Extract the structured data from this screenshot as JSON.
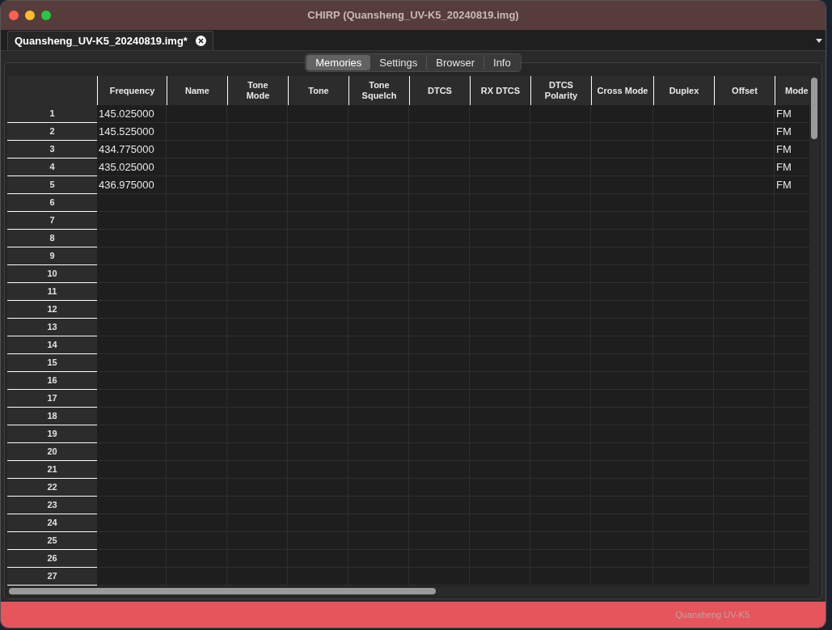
{
  "window": {
    "title": "CHIRP (Quansheng_UV-K5_20240819.img)"
  },
  "document_tab": {
    "label": "Quansheng_UV-K5_20240819.img*"
  },
  "tabs": [
    {
      "label": "Memories",
      "selected": true
    },
    {
      "label": "Settings",
      "selected": false
    },
    {
      "label": "Browser",
      "selected": false
    },
    {
      "label": "Info",
      "selected": false
    }
  ],
  "table": {
    "columns": [
      "Frequency",
      "Name",
      "Tone\nMode",
      "Tone",
      "Tone\nSquelch",
      "DTCS",
      "RX DTCS",
      "DTCS\nPolarity",
      "Cross Mode",
      "Duplex",
      "Offset",
      "Mode"
    ],
    "rows": [
      {
        "number": "1",
        "frequency": "145.025000",
        "mode": "FM"
      },
      {
        "number": "2",
        "frequency": "145.525000",
        "mode": "FM"
      },
      {
        "number": "3",
        "frequency": "434.775000",
        "mode": "FM"
      },
      {
        "number": "4",
        "frequency": "435.025000",
        "mode": "FM"
      },
      {
        "number": "5",
        "frequency": "436.975000",
        "mode": "FM"
      },
      {
        "number": "6"
      },
      {
        "number": "7"
      },
      {
        "number": "8"
      },
      {
        "number": "9"
      },
      {
        "number": "10"
      },
      {
        "number": "11"
      },
      {
        "number": "12"
      },
      {
        "number": "13"
      },
      {
        "number": "14"
      },
      {
        "number": "15"
      },
      {
        "number": "16"
      },
      {
        "number": "17"
      },
      {
        "number": "18"
      },
      {
        "number": "19"
      },
      {
        "number": "20"
      },
      {
        "number": "21"
      },
      {
        "number": "22"
      },
      {
        "number": "23"
      },
      {
        "number": "24"
      },
      {
        "number": "25"
      },
      {
        "number": "26"
      },
      {
        "number": "27"
      }
    ]
  },
  "status_bar": {
    "text": "Quansheng UV-K5"
  }
}
